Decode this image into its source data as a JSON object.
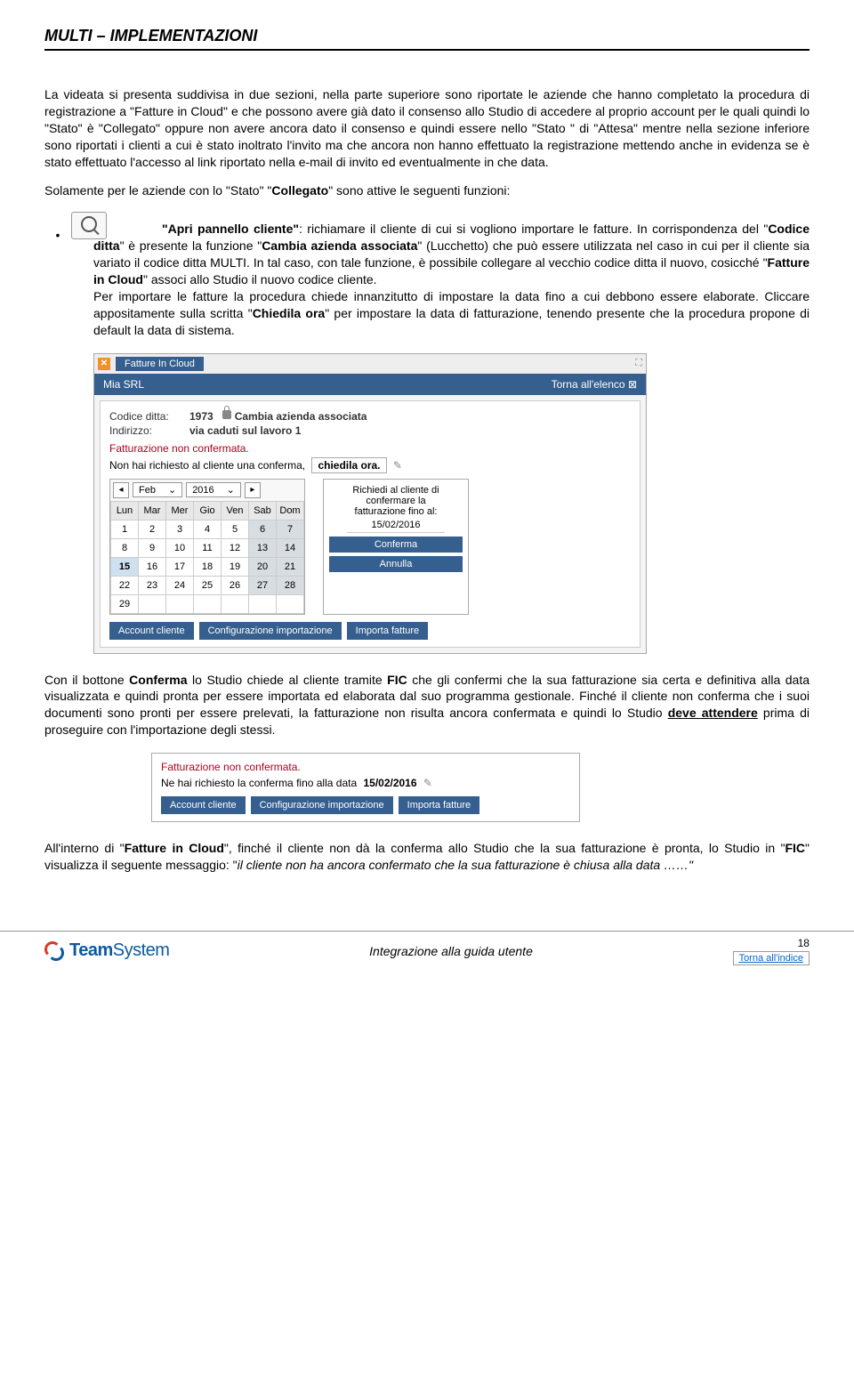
{
  "header": {
    "title": "MULTI – IMPLEMENTAZIONI"
  },
  "para1": "La videata si presenta suddivisa in due sezioni, nella parte superiore sono riportate le aziende che hanno completato la procedura di registrazione a \"Fatture in Cloud\" e che possono avere già dato il consenso allo Studio di accedere al proprio account per le quali quindi lo \"Stato\" è \"Collegato\" oppure non avere ancora dato il consenso e quindi essere nello \"Stato \" di \"Attesa\" mentre nella sezione inferiore sono riportati i clienti a cui è stato inoltrato l'invito ma che ancora non hanno effettuato la registrazione mettendo anche in evidenza se è stato effettuato l'accesso al link riportato nella e-mail di invito ed eventualmente in che data.",
  "para2_prefix": "Solamente per le aziende con lo \"Stato\" \"",
  "para2_bold": "Collegato",
  "para2_suffix": "\" sono attive le seguenti funzioni:",
  "bullet": {
    "b1": "\"Apri pannello cliente\"",
    "t1": ": richiamare il cliente di cui si vogliono importare le fatture. In corrispondenza del \"",
    "b2": "Codice ditta",
    "t2": "\" è presente la funzione \"",
    "b3": "Cambia azienda associata",
    "t3": "\" (Lucchetto) che può essere utilizzata nel caso in cui per il cliente sia variato il codice ditta MULTI. In tal caso, con tale funzione, è possibile collegare al vecchio codice ditta il nuovo, cosicché \"",
    "b4": "Fatture in Cloud",
    "t4": "\" associ allo Studio il nuovo codice cliente.",
    "l2": "Per importare le fatture la procedura chiede innanzitutto di impostare la data fino a cui debbono essere elaborate. Cliccare appositamente sulla scritta \"",
    "b5": "Chiedila ora",
    "t5": "\" per impostare la data di fatturazione, tenendo presente che la procedura propone di default la data di sistema."
  },
  "shot1": {
    "tab": "Fatture In Cloud",
    "company": "Mia SRL",
    "back": "Torna all'elenco",
    "code_label": "Codice ditta:",
    "code_val": "1973",
    "change_company": "Cambia azienda associata",
    "addr_label": "Indirizzo:",
    "addr_val": "via caduti sul lavoro 1",
    "warn_title": "Fatturazione non confermata.",
    "warn_msg_prefix": "Non hai richiesto al cliente una conferma,",
    "chiedila": "chiedila ora.",
    "cal": {
      "month": "Feb",
      "year": "2016",
      "days": [
        "Lun",
        "Mar",
        "Mer",
        "Gio",
        "Ven",
        "Sab",
        "Dom"
      ],
      "w1": [
        "1",
        "2",
        "3",
        "4",
        "5",
        "6",
        "7"
      ],
      "w2": [
        "8",
        "9",
        "10",
        "11",
        "12",
        "13",
        "14"
      ],
      "w3": [
        "15",
        "16",
        "17",
        "18",
        "19",
        "20",
        "21"
      ],
      "w4": [
        "22",
        "23",
        "24",
        "25",
        "26",
        "27",
        "28"
      ],
      "w5": [
        "29",
        "",
        "",
        "",
        "",
        "",
        ""
      ]
    },
    "popup": {
      "l1": "Richiedi al cliente di",
      "l2": "confermare la",
      "l3": "fatturazione fino al:",
      "date": "15/02/2016",
      "confirm": "Conferma",
      "cancel": "Annulla"
    },
    "btn1": "Account cliente",
    "btn2": "Configurazione importazione",
    "btn3": "Importa fatture"
  },
  "para3": {
    "t0": "Con il bottone ",
    "b1": "Conferma",
    "t1": " lo Studio chiede al cliente tramite ",
    "b2": "FIC",
    "t2": " che gli confermi che la sua fatturazione sia certa e definitiva alla data visualizzata e quindi pronta per essere importata ed elaborata dal suo programma gestionale. Finché il cliente non conferma che i suoi documenti sono pronti per essere prelevati, la fatturazione non risulta ancora confermata e quindi lo Studio ",
    "u1": "deve attendere",
    "t3": " prima di proseguire con l'importazione degli stessi."
  },
  "shot2": {
    "title": "Fatturazione non confermata.",
    "msg": "Ne hai richiesto la conferma fino alla data",
    "date": "15/02/2016",
    "btn1": "Account cliente",
    "btn2": "Configurazione importazione",
    "btn3": "Importa fatture"
  },
  "para4": {
    "t0": "All'interno di \"",
    "b1": "Fatture in Cloud",
    "t1": "\", finché il cliente non dà la conferma allo Studio che la sua fatturazione è pronta, lo Studio in \"",
    "b2": "FIC",
    "t2": "\" visualizza il seguente messaggio: \"",
    "i1": "il cliente non ha ancora confermato che la sua fatturazione è chiusa alla data ……\""
  },
  "footer": {
    "brand1": "Team",
    "brand2": "System",
    "center": "Integrazione alla guida utente",
    "page": "18",
    "link": "Torna all'indice"
  }
}
